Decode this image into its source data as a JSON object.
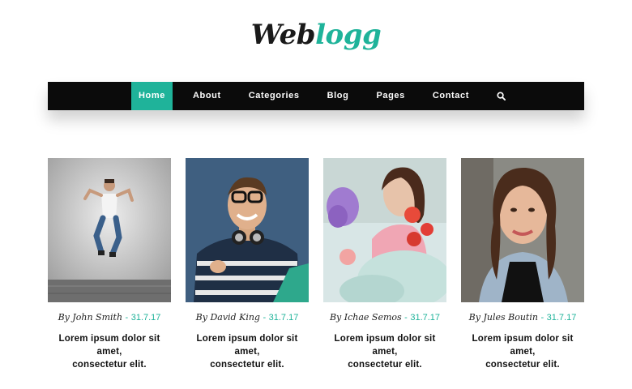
{
  "logo": {
    "part1": "Web",
    "part2": "logg"
  },
  "nav": {
    "items": [
      {
        "label": "Home",
        "active": true
      },
      {
        "label": "About"
      },
      {
        "label": "Categories"
      },
      {
        "label": "Blog"
      },
      {
        "label": "Pages"
      },
      {
        "label": "Contact"
      }
    ],
    "search_icon": "search-icon"
  },
  "posts": [
    {
      "author": "By John Smith",
      "separator": "-",
      "date": "31.7.17",
      "excerpt_line1": "Lorem ipsum dolor sit amet,",
      "excerpt_line2": "consectetur elit."
    },
    {
      "author": "By David King",
      "separator": "-",
      "date": "31.7.17",
      "excerpt_line1": "Lorem ipsum dolor sit amet,",
      "excerpt_line2": "consectetur elit."
    },
    {
      "author": "By Ichae Semos",
      "separator": "-",
      "date": "31.7.17",
      "excerpt_line1": "Lorem ipsum dolor sit amet,",
      "excerpt_line2": "consectetur elit."
    },
    {
      "author": "By Jules Boutin",
      "separator": "-",
      "date": "31.7.17",
      "excerpt_line1": "Lorem ipsum dolor sit amet,",
      "excerpt_line2": "consectetur elit."
    }
  ],
  "colors": {
    "accent": "#1fb39a",
    "nav_bg": "#0b0b0b",
    "text": "#111111"
  }
}
